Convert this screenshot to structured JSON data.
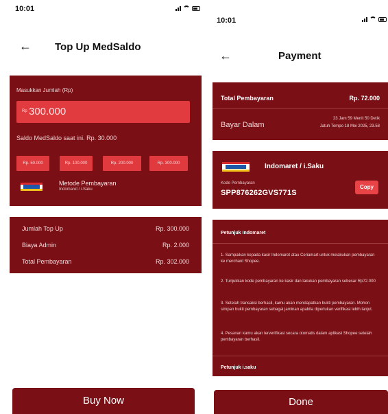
{
  "left": {
    "status_time": "10:01",
    "title": "Top Up MedSaldo",
    "amount_label": "Masukkan Jumlah (Rp)",
    "amount_prefix": "Rp",
    "amount_value": "300.000",
    "current_balance": "Saldo MedSaldo saat ini. Rp. 30.000",
    "quick_amounts": [
      "Rp. 50.000",
      "Rp. 100.000",
      "Rp. 200.000",
      "Rp. 300.000"
    ],
    "payment_method_title": "Metode Pembayaran",
    "payment_method_sub": "Indomaret / i.Saku",
    "summary": [
      {
        "label": "Jumlah Top Up",
        "value": "Rp. 300.000"
      },
      {
        "label": "Biaya Admin",
        "value": "Rp. 2.000"
      },
      {
        "label": "Total Pembayaran",
        "value": "Rp. 302.000"
      }
    ],
    "buy_label": "Buy Now"
  },
  "right": {
    "status_time": "10:01",
    "title": "Payment",
    "total_label": "Total Pembayaran",
    "total_value": "Rp. 72.000",
    "pay_within_label": "Bayar Dalam",
    "pay_within_time": "23 Jam 59 Menit 50 Detik",
    "due": "Jatuh Tempo 18 Mei 2025, 23.58",
    "merchant_name": "Indomaret / i.Saku",
    "kode_label": "Kode Pembayaran",
    "kode_value": "SPP876262GVS771S",
    "copy_label": "Copy",
    "instructions_title": "Petunjuk Indomaret",
    "steps": [
      "1. Sampaikan kepada kasir Indomaret atau Ceriamart untuk melakukan pembayaran ke merchant Shopee.",
      "2. Tunjukkan kode pembayaran ke kasir dan lakukan pembayaran sebesar Rp72.000",
      "3. Setelah transaksi berhasil, kamu akan mendapatkan bukti pembayaran. Mohon simpan bukti pembayaran sebagai jaminan apabila diperlukan verifikasi lebih lanjut.",
      "4. Pesanan kamu akan terverifikasi secara otomatis dalam aplikasi Shopee setelah pembayaran berhasil."
    ],
    "footer_title": "Petunjuk i.saku",
    "done_label": "Done"
  },
  "colors": {
    "primary": "#7a1015",
    "accent": "#e23b3f"
  }
}
